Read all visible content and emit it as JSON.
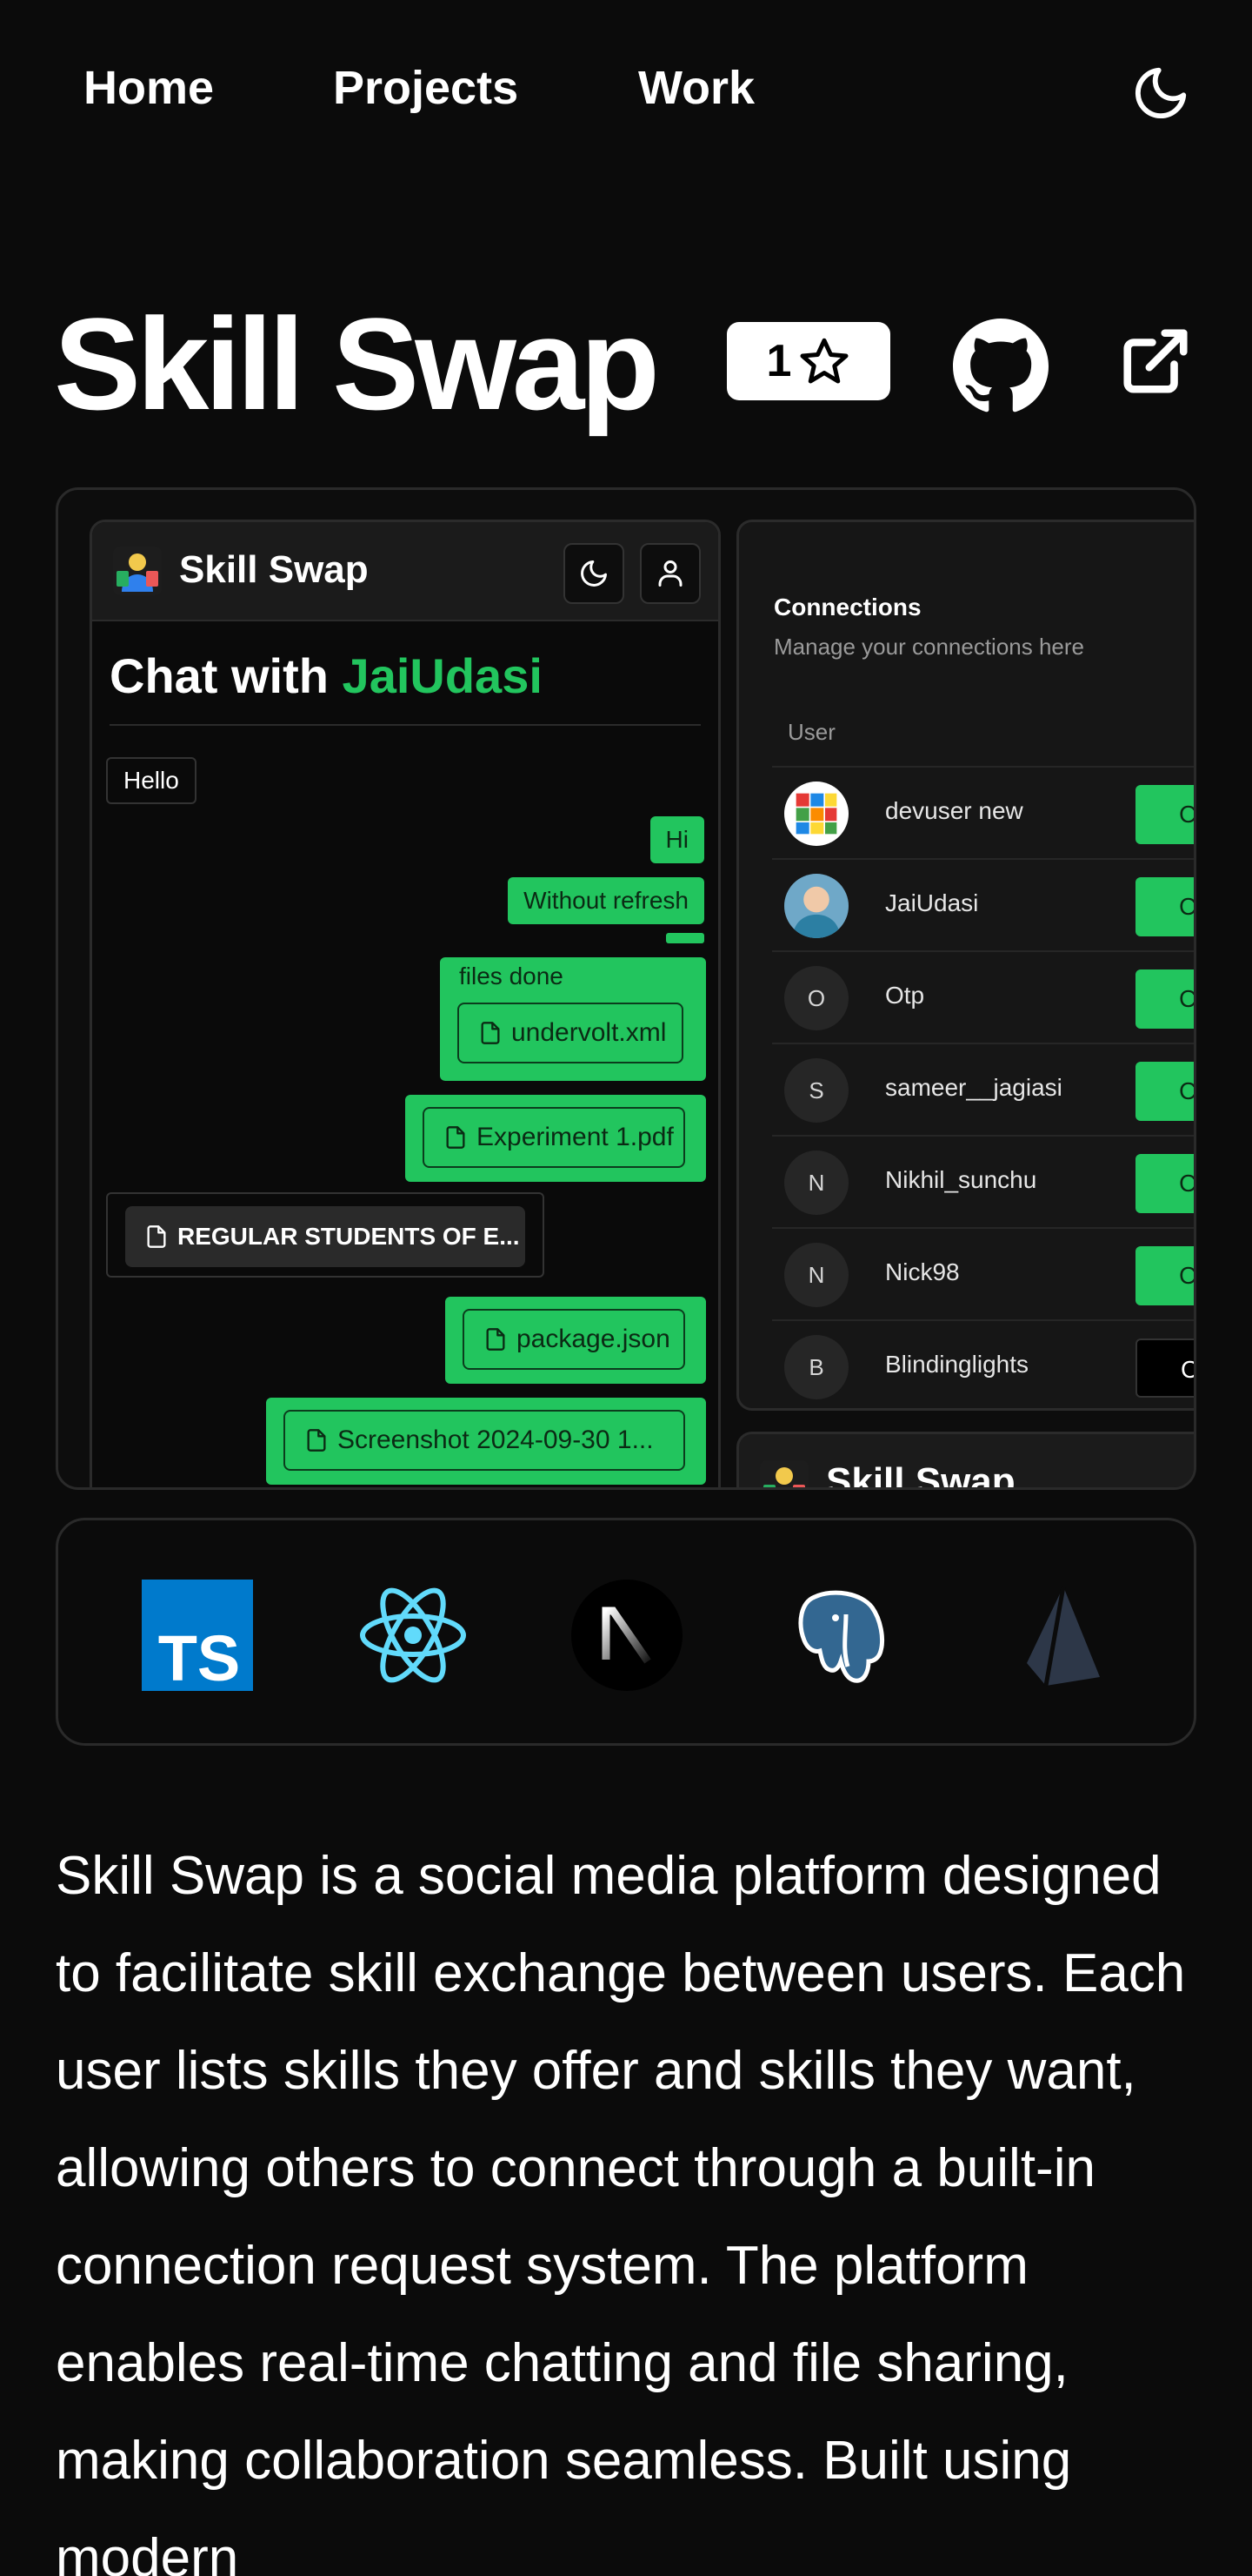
{
  "nav": {
    "links": [
      "Home",
      "Projects",
      "Work"
    ],
    "theme_toggle_icon": "moon-icon"
  },
  "project": {
    "title": "Skill Swap",
    "star_count": "1",
    "icons": [
      "star-icon",
      "github-icon",
      "external-link-icon"
    ]
  },
  "preview": {
    "chat_app": {
      "app_name": "Skill Swap",
      "chat_title_prefix": "Chat with",
      "chat_user": "JaiUdasi",
      "messages": {
        "hello": "Hello",
        "hi": "Hi",
        "without_refresh": "Without refresh",
        "files_done": "files done",
        "file_undervolt": "undervolt.xml",
        "file_experiment": "Experiment 1.pdf",
        "file_regular": "REGULAR STUDENTS OF E...",
        "file_package": "package.json",
        "file_screenshot": "Screenshot 2024-09-30 1..."
      }
    },
    "connections": {
      "title": "Connections",
      "subtitle": "Manage your connections here",
      "column": "User",
      "rows": [
        {
          "initial": "",
          "name": "devuser new",
          "action": "C"
        },
        {
          "initial": "",
          "name": "JaiUdasi",
          "action": "C"
        },
        {
          "initial": "O",
          "name": "Otp",
          "action": "C"
        },
        {
          "initial": "S",
          "name": "sameer__jagiasi",
          "action": "C"
        },
        {
          "initial": "N",
          "name": "Nikhil_sunchu",
          "action": "C"
        },
        {
          "initial": "N",
          "name": "Nick98",
          "action": "C"
        },
        {
          "initial": "B",
          "name": "Blindinglights",
          "action": "Ca"
        }
      ]
    },
    "peek_app_name": "Skill Swap"
  },
  "tech_stack": {
    "icons": [
      "typescript-icon",
      "react-icon",
      "nextjs-icon",
      "postgresql-icon",
      "prisma-icon"
    ],
    "ts_label": "TS"
  },
  "description": "Skill Swap is a social media platform designed to facilitate skill exchange between users. Each user lists skills they offer and skills they want, allowing others to connect through a built-in connection request system. The platform enables real-time chatting and file sharing, making collaboration seamless. Built using modern",
  "colors": {
    "background": "#0b0b0b",
    "accent_green": "#22c55e",
    "text": "#ffffff"
  }
}
